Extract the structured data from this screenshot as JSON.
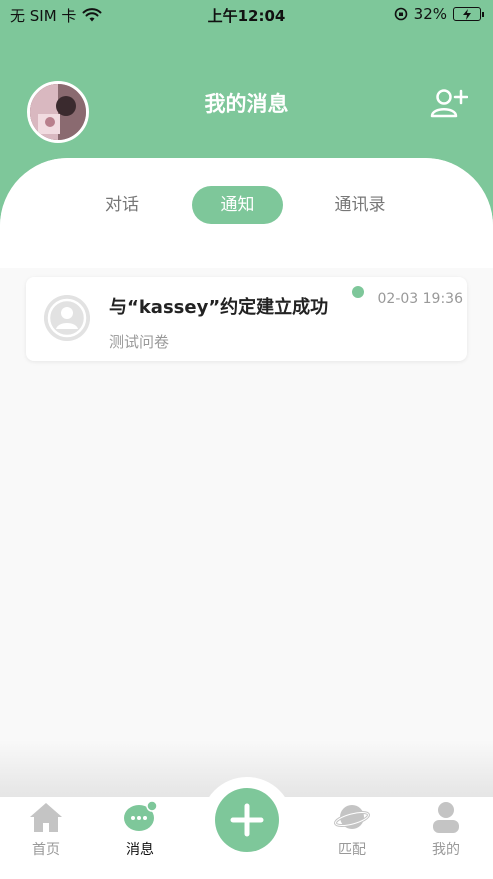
{
  "status_bar": {
    "carrier": "无 SIM 卡",
    "time": "上午12:04",
    "battery": "32%"
  },
  "header": {
    "title": "我的消息",
    "avatar_icon": "user-avatar",
    "add_friend_icon": "add-user-icon"
  },
  "tabs": [
    {
      "label": "对话",
      "active": false
    },
    {
      "label": "通知",
      "active": true
    },
    {
      "label": "通讯录",
      "active": false
    }
  ],
  "notifications": [
    {
      "title": "与“kassey”约定建立成功",
      "subtitle": "测试问卷",
      "time": "02-03 19:36",
      "unread": true,
      "avatar_icon": "default-user-icon"
    }
  ],
  "bottom_nav": [
    {
      "label": "首页",
      "icon": "home-icon",
      "active": false
    },
    {
      "label": "消息",
      "icon": "chat-icon",
      "active": true
    },
    {
      "label": "",
      "icon": "plus-icon",
      "active": false
    },
    {
      "label": "匹配",
      "icon": "planet-icon",
      "active": false
    },
    {
      "label": "我的",
      "icon": "person-icon",
      "active": false
    }
  ],
  "colors": {
    "accent": "#7ec79a",
    "background": "#f9f9f9",
    "text_primary": "#222222",
    "text_secondary": "#999999"
  }
}
